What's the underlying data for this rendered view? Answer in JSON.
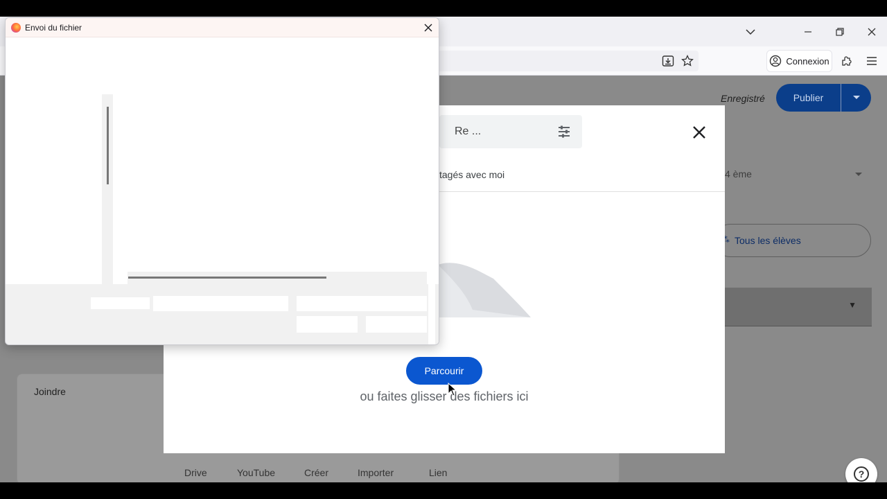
{
  "browser": {
    "login_label": "Connexion",
    "icons": [
      "firefox-icon",
      "chevron-down-icon",
      "minimize-icon",
      "restore-icon",
      "close-icon",
      "download-icon",
      "star-icon",
      "account-icon",
      "extensions-icon",
      "menu-icon"
    ]
  },
  "page": {
    "saved_label": "Enregistré",
    "publish_label": "Publier",
    "class_select_text": "4 ème",
    "students_label": "Tous les élèves",
    "attach_label": "Joindre",
    "attach_options": [
      "Drive",
      "YouTube",
      "Créer",
      "Importer",
      "Lien"
    ]
  },
  "picker": {
    "search_text": "Re ...",
    "tab_label": "tagés avec moi",
    "browse_label": "Parcourir",
    "drop_message": "ou faites glisser des fichiers ici"
  },
  "file_dialog": {
    "title": "Envoi du fichier"
  },
  "colors": {
    "accent_blue": "#0b57d0",
    "publish_dim": "#0b3e8a"
  }
}
